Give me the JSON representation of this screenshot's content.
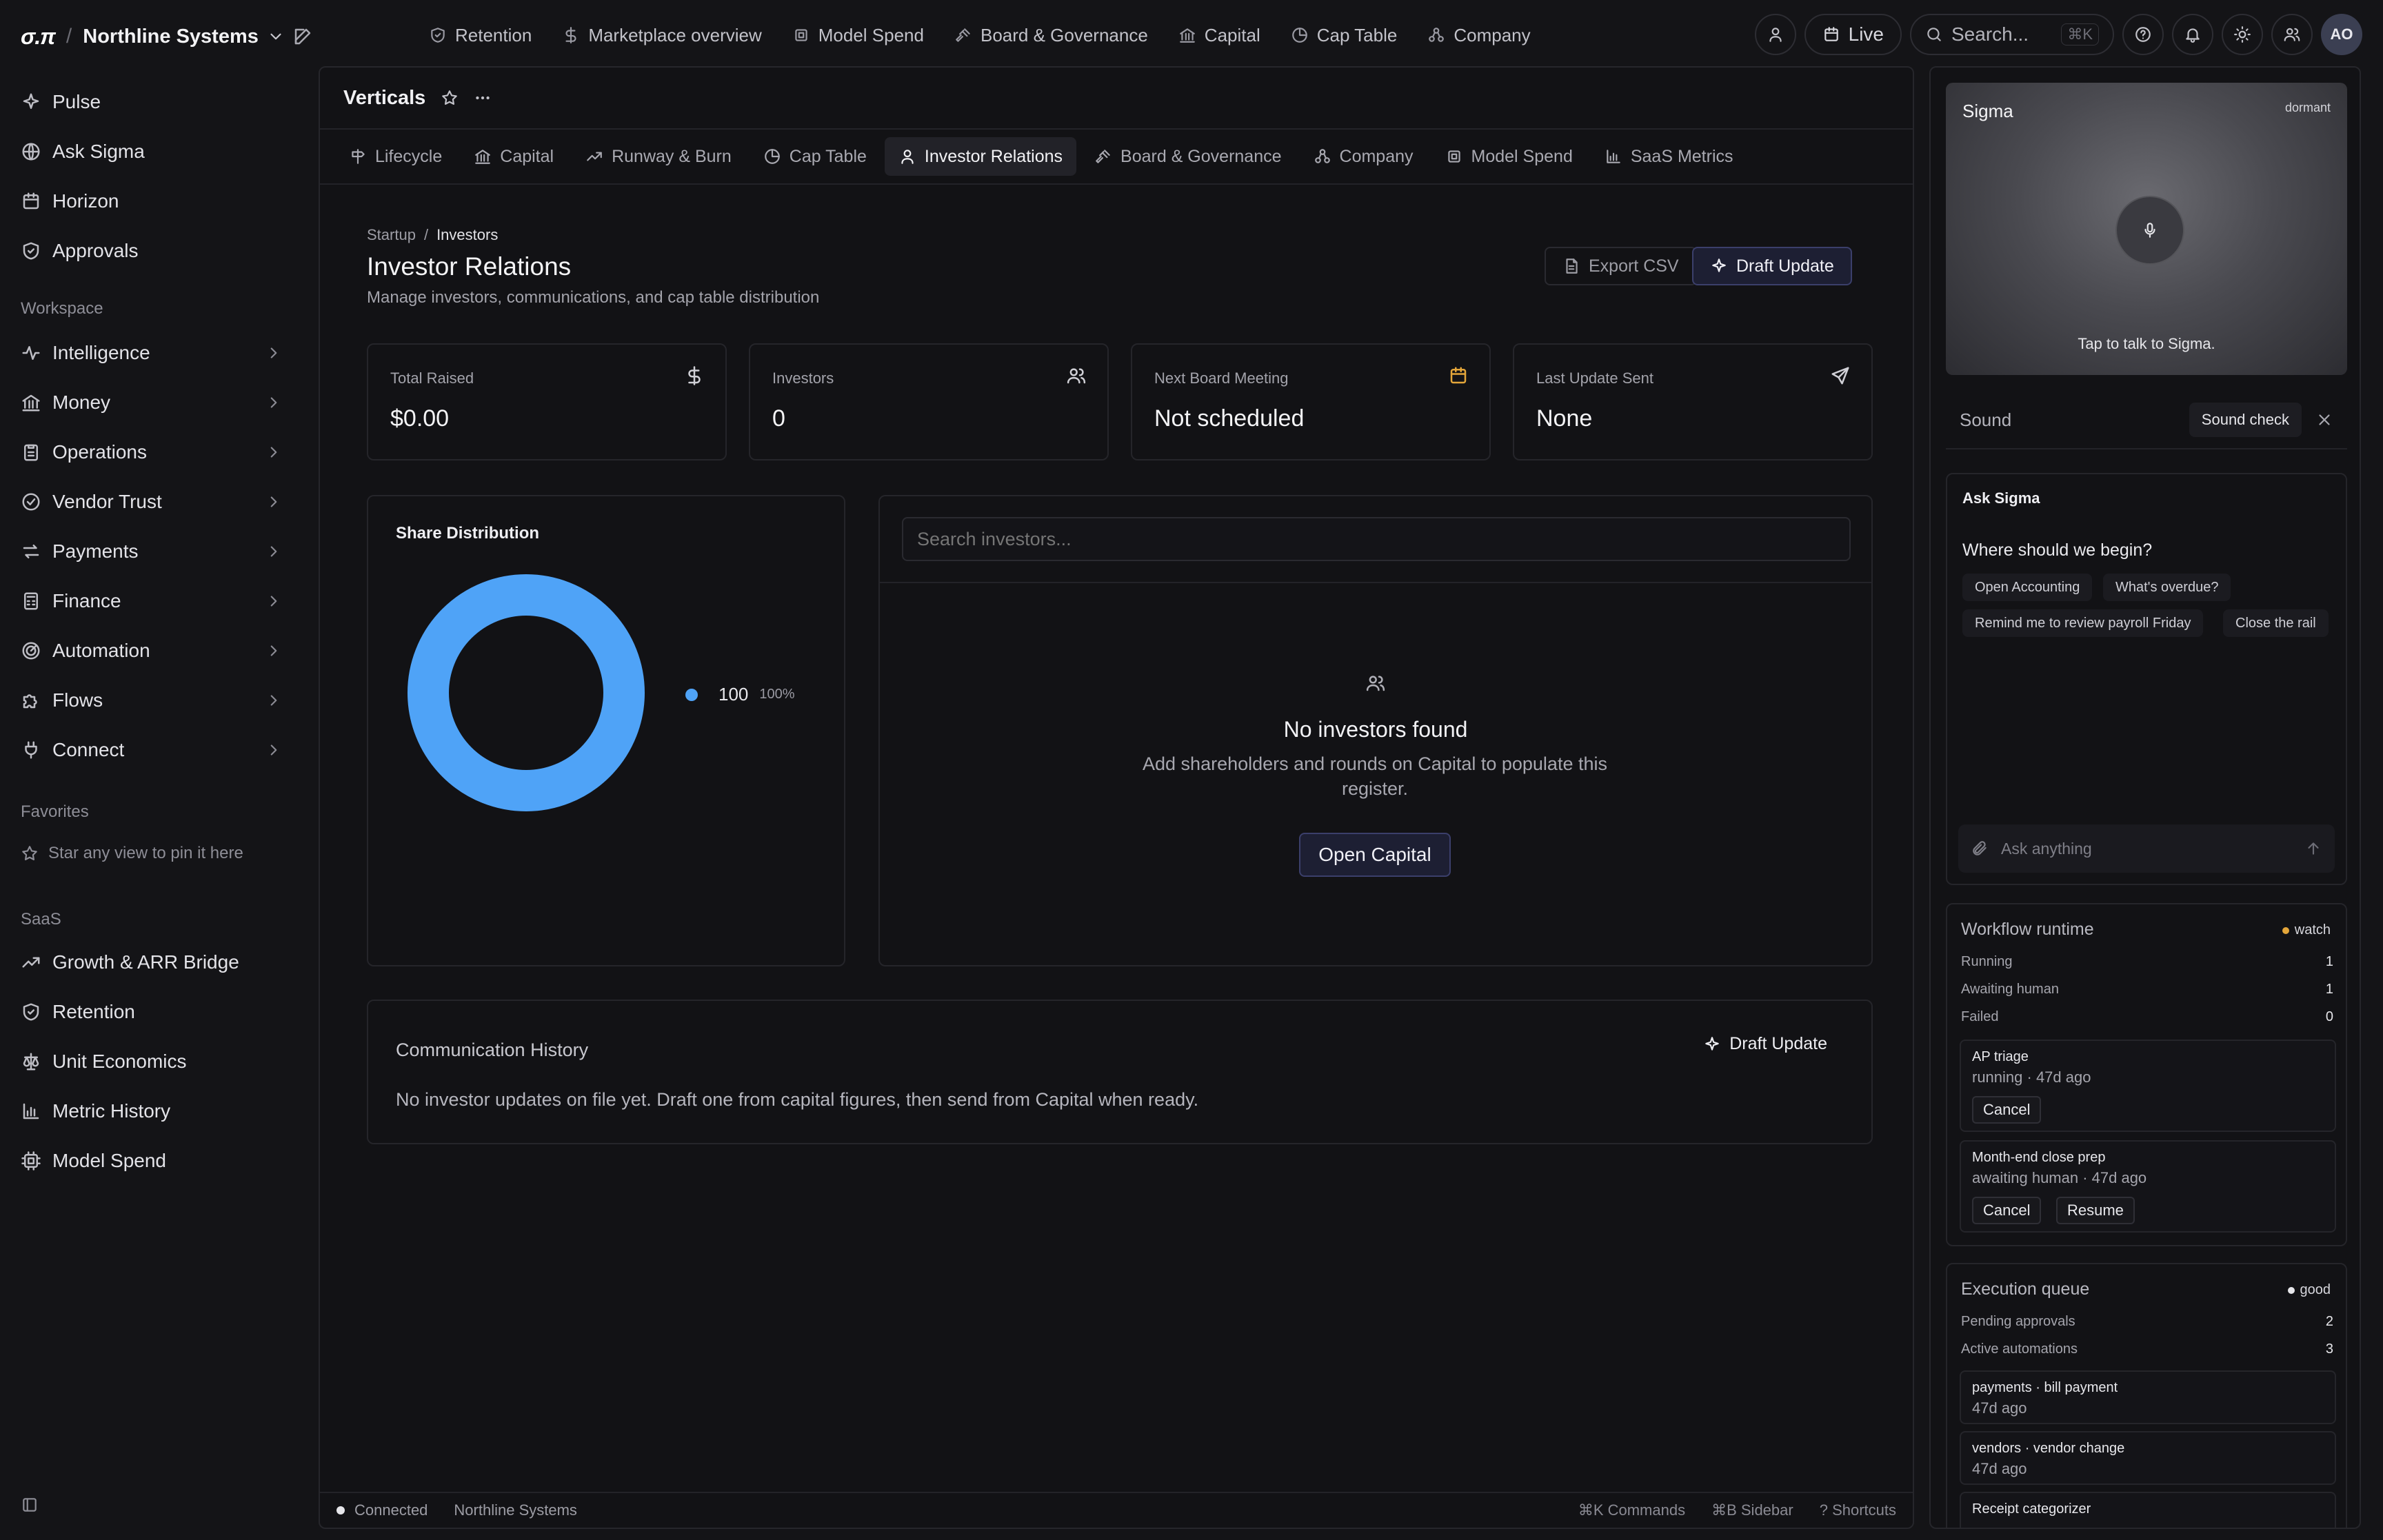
{
  "topbar": {
    "logo": "σ.π",
    "org": "Northline Systems",
    "nav": [
      {
        "label": "Retention",
        "icon": "shield-icon"
      },
      {
        "label": "Marketplace overview",
        "icon": "dollar-icon"
      },
      {
        "label": "Model Spend",
        "icon": "chip-icon"
      },
      {
        "label": "Board & Governance",
        "icon": "gavel-icon"
      },
      {
        "label": "Capital",
        "icon": "bank-icon"
      },
      {
        "label": "Cap Table",
        "icon": "pie-icon"
      },
      {
        "label": "Company",
        "icon": "org-icon"
      }
    ],
    "live_label": "Live",
    "search_placeholder": "Search...",
    "search_shortcut": "⌘K",
    "avatar_initials": "AO"
  },
  "sidebar": {
    "primary": [
      "Pulse",
      "Ask Sigma",
      "Horizon",
      "Approvals"
    ],
    "workspace_heading": "Workspace",
    "workspace": [
      "Intelligence",
      "Money",
      "Operations",
      "Vendor Trust",
      "Payments",
      "Finance",
      "Automation",
      "Flows",
      "Connect"
    ],
    "favorites_heading": "Favorites",
    "favorites_hint": "Star any view to pin it here",
    "saas_heading": "SaaS",
    "saas": [
      "Growth & ARR Bridge",
      "Retention",
      "Unit Economics",
      "Metric History",
      "Model Spend"
    ]
  },
  "main": {
    "title": "Verticals",
    "tabs": [
      "Lifecycle",
      "Capital",
      "Runway & Burn",
      "Cap Table",
      "Investor Relations",
      "Board & Governance",
      "Company",
      "Model Spend",
      "SaaS Metrics"
    ],
    "active_tab": "Investor Relations",
    "breadcrumb": [
      "Startup",
      "Investors"
    ],
    "page_title": "Investor Relations",
    "page_subtitle": "Manage investors, communications, and cap table distribution",
    "export_label": "Export CSV",
    "draft_label": "Draft Update",
    "stats": [
      {
        "label": "Total Raised",
        "value": "$0.00",
        "icon": "dollar-icon"
      },
      {
        "label": "Investors",
        "value": "0",
        "icon": "users-icon"
      },
      {
        "label": "Next Board Meeting",
        "value": "Not scheduled",
        "icon": "calendar-icon"
      },
      {
        "label": "Last Update Sent",
        "value": "None",
        "icon": "send-icon"
      }
    ],
    "share_title": "Share Distribution",
    "investor_search_placeholder": "Search investors...",
    "empty_title": "No investors found",
    "empty_subtitle": "Add shareholders and rounds on Capital to populate this register.",
    "open_capital_label": "Open Capital",
    "comm_title": "Communication History",
    "comm_draft_label": "Draft Update",
    "comm_empty": "No investor updates on file yet. Draft one from capital figures, then send from Capital when ready.",
    "status": {
      "connection": "Connected",
      "org": "Northline Systems",
      "shortcuts": [
        "⌘K Commands",
        "⌘B Sidebar",
        "? Shortcuts"
      ]
    }
  },
  "chart_data": {
    "type": "pie",
    "title": "Share Distribution",
    "categories": [
      ""
    ],
    "values": [
      100
    ],
    "percent_labels": [
      "100%"
    ],
    "colors": [
      "#4fa3f7"
    ],
    "donut": true
  },
  "right": {
    "voice_name": "Sigma",
    "voice_status": "dormant",
    "voice_hint": "Tap to talk to Sigma.",
    "sound_label": "Sound",
    "sound_check_label": "Sound check",
    "ask_title": "Ask Sigma",
    "ask_question": "Where should we begin?",
    "chips": [
      "Open Accounting",
      "What's overdue?",
      "Remind me to review payroll Friday",
      "Close the rail"
    ],
    "ask_placeholder": "Ask anything",
    "runtime": {
      "title": "Workflow runtime",
      "badge": "watch",
      "badge_color": "#e4a63a",
      "rows": [
        {
          "label": "Running",
          "value": "1"
        },
        {
          "label": "Awaiting human",
          "value": "1"
        },
        {
          "label": "Failed",
          "value": "0"
        }
      ],
      "jobs": [
        {
          "name": "AP triage",
          "meta": "running · 47d ago",
          "cancel": "Cancel"
        },
        {
          "name": "Month-end close prep",
          "meta": "awaiting human · 47d ago",
          "cancel": "Cancel",
          "resume": "Resume"
        }
      ]
    },
    "queue": {
      "title": "Execution queue",
      "badge": "good",
      "badge_color": "#e6e6ea",
      "rows": [
        {
          "label": "Pending approvals",
          "value": "2"
        },
        {
          "label": "Active automations",
          "value": "3"
        }
      ],
      "items": [
        {
          "name": "payments · bill payment",
          "meta": "47d ago"
        },
        {
          "name": "vendors · vendor change",
          "meta": "47d ago"
        },
        {
          "name": "Receipt categorizer",
          "meta": ""
        }
      ]
    }
  }
}
